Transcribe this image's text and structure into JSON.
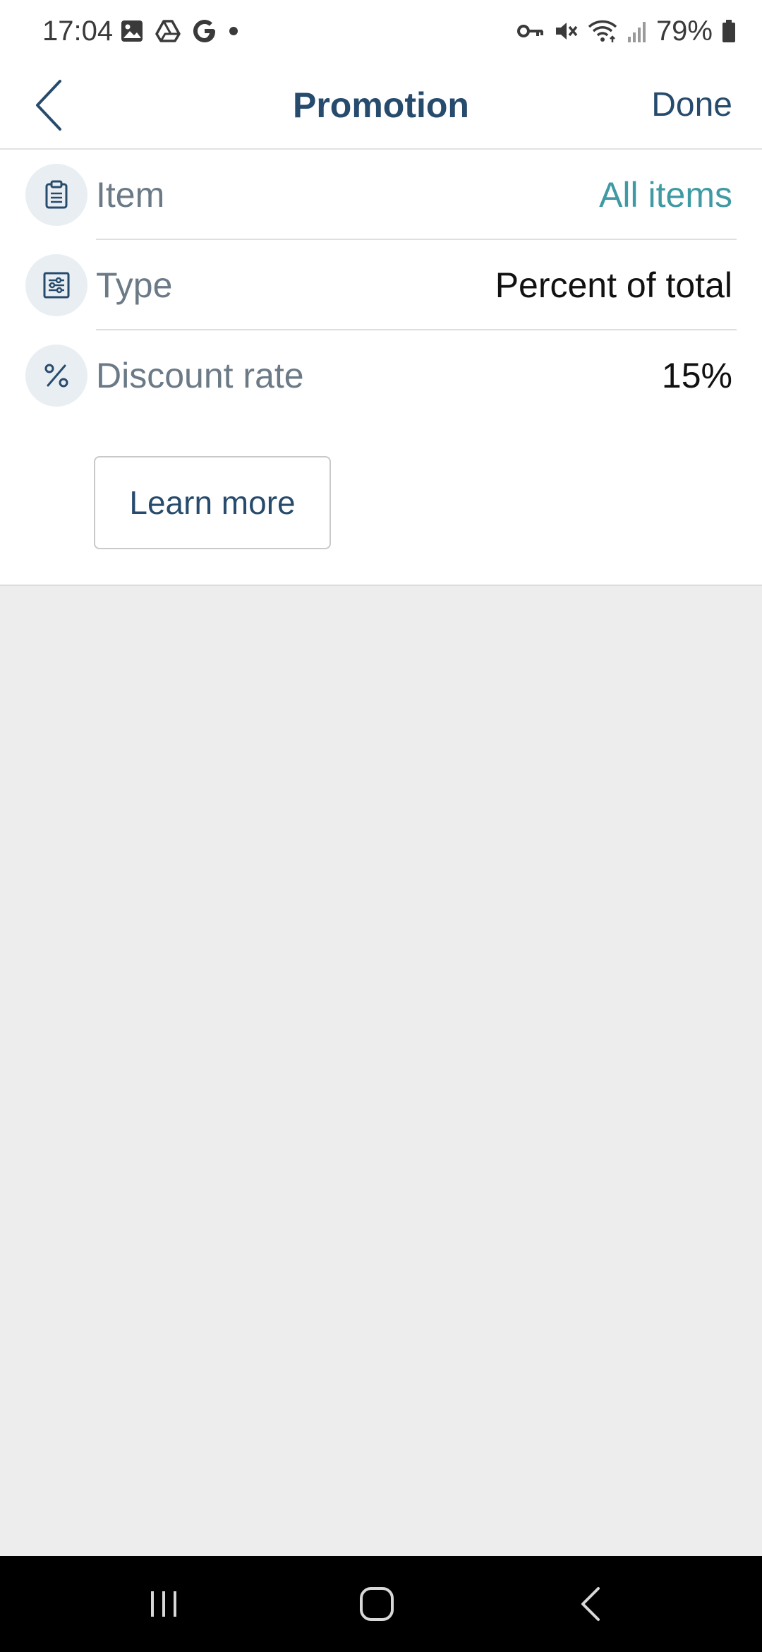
{
  "status_bar": {
    "time": "17:04",
    "battery_percent": "79%",
    "left_icons": [
      "image-icon",
      "drive-icon",
      "google-icon",
      "dot-icon"
    ],
    "right_icons": [
      "key-icon",
      "mute-icon",
      "wifi-icon",
      "signal-icon",
      "battery-icon"
    ]
  },
  "header": {
    "title": "Promotion",
    "done_label": "Done",
    "back_icon": "chevron-left-icon"
  },
  "rows": [
    {
      "label": "Item",
      "value": "All items",
      "icon": "clipboard-icon",
      "value_color": "#3f9aa3"
    },
    {
      "label": "Type",
      "value": "Percent of total",
      "icon": "sliders-icon",
      "value_color": "#111111"
    },
    {
      "label": "Discount rate",
      "value": "15%",
      "icon": "percent-icon",
      "value_color": "#111111"
    }
  ],
  "learn_more_label": "Learn more",
  "colors": {
    "primary": "#274b6d",
    "accent": "#3f9aa3",
    "label_gray": "#6b7a86",
    "background": "#ededed"
  },
  "nav_bar": {
    "icons": [
      "recents-icon",
      "home-icon",
      "back-icon"
    ]
  }
}
